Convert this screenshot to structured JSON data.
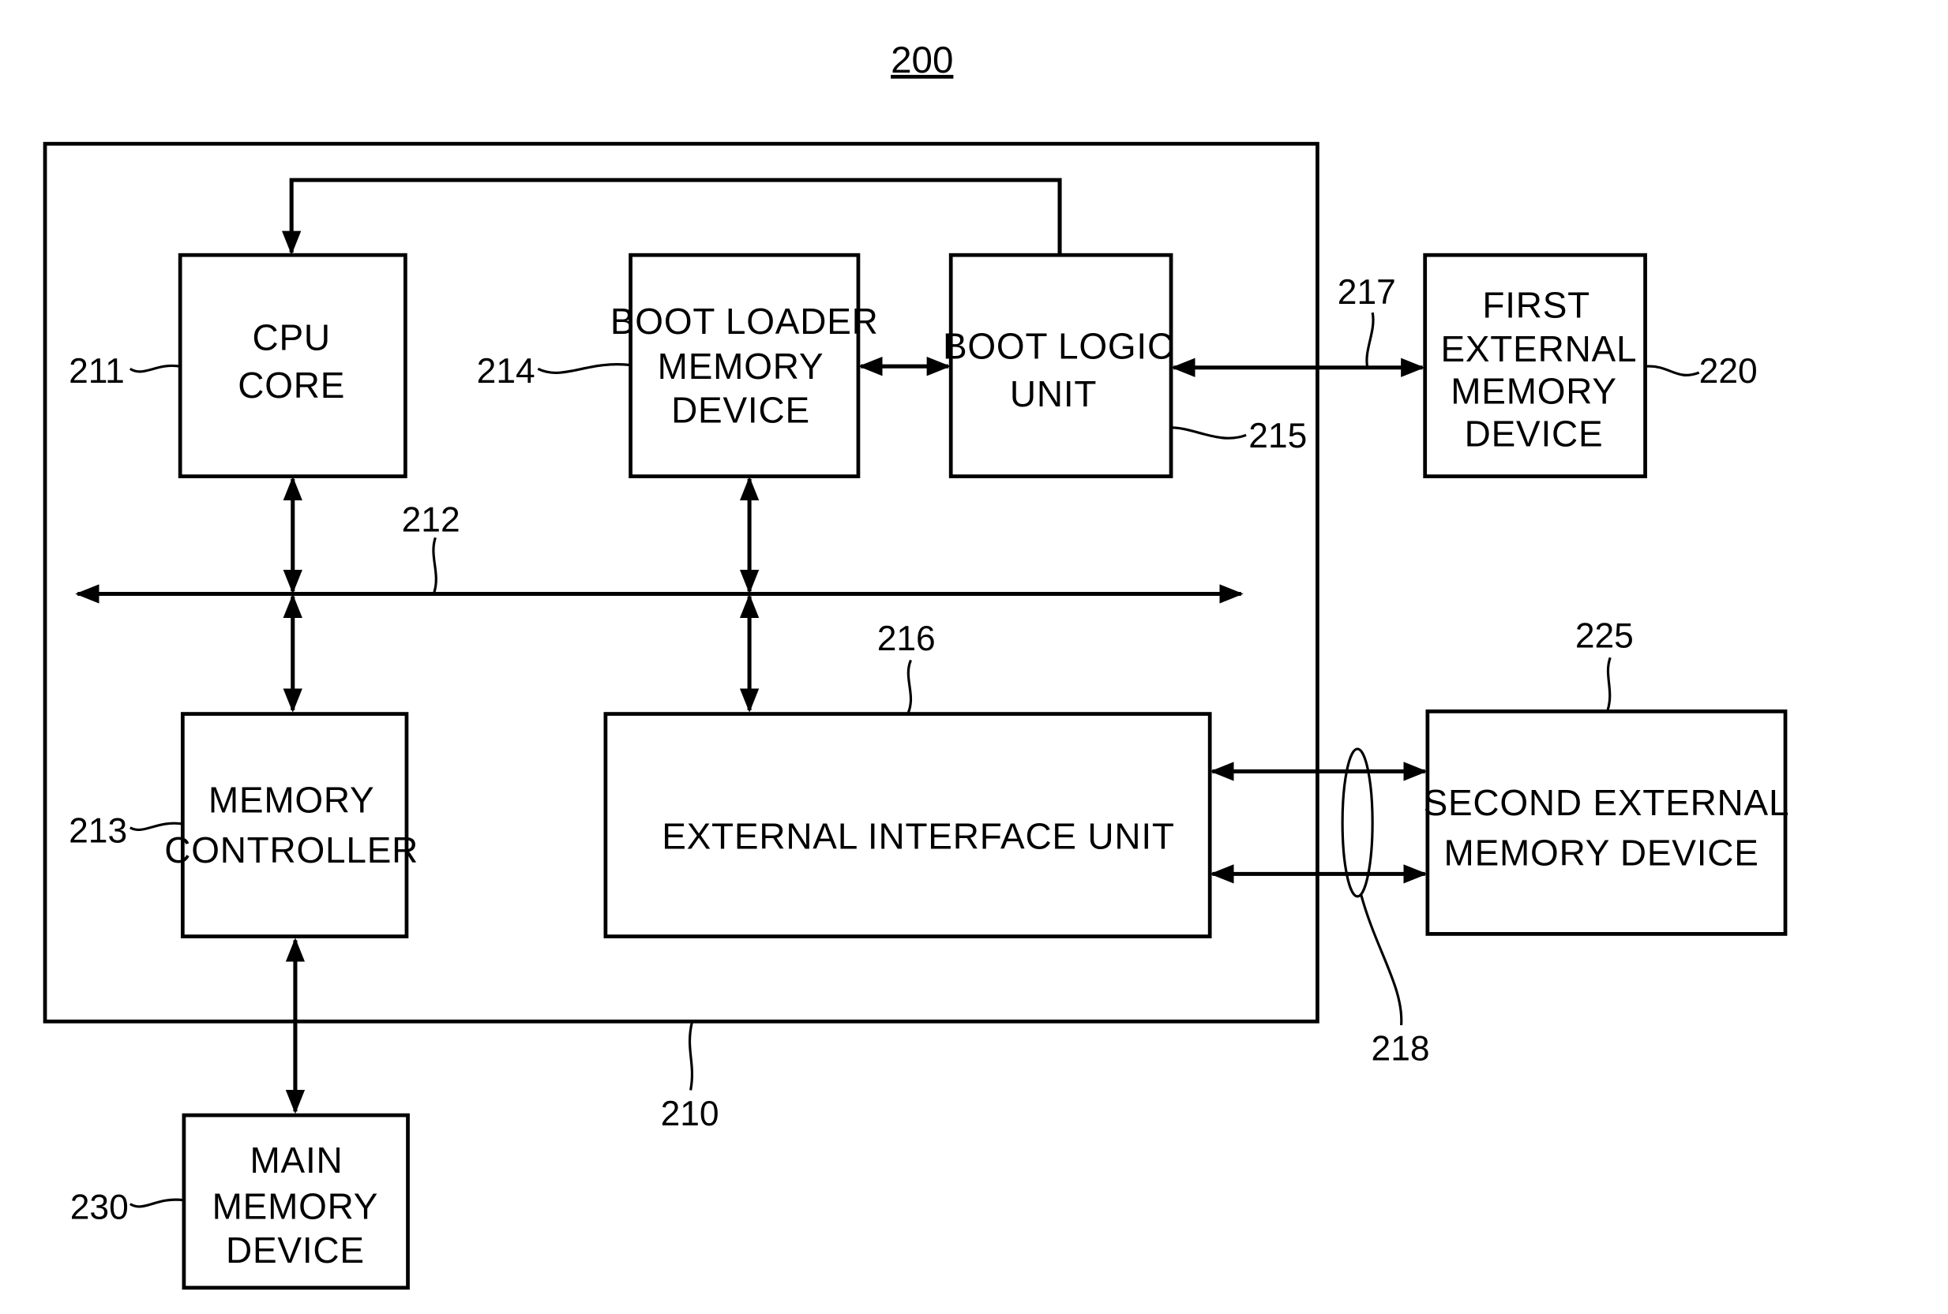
{
  "figure": {
    "reference": "200"
  },
  "blocks": {
    "system": {
      "ref": "210"
    },
    "cpu_core": {
      "ref": "211",
      "lines": [
        "CPU",
        "CORE"
      ]
    },
    "bus": {
      "ref": "212"
    },
    "memory_controller": {
      "ref": "213",
      "lines": [
        "MEMORY",
        "CONTROLLER"
      ]
    },
    "boot_loader_memory": {
      "ref": "214",
      "lines": [
        "BOOT LOADER",
        "MEMORY",
        "DEVICE"
      ]
    },
    "boot_logic_unit": {
      "ref": "215",
      "lines": [
        "BOOT LOGIC",
        "UNIT"
      ]
    },
    "external_interface_unit": {
      "ref": "216",
      "lines": [
        "EXTERNAL  INTERFACE UNIT"
      ]
    },
    "first_link": {
      "ref": "217"
    },
    "second_link": {
      "ref": "218"
    },
    "first_external_memory": {
      "ref": "220",
      "lines": [
        "FIRST",
        "EXTERNAL",
        "MEMORY",
        "DEVICE"
      ]
    },
    "second_external_memory": {
      "ref": "225",
      "lines": [
        "SECOND EXTERNAL",
        "MEMORY DEVICE"
      ]
    },
    "main_memory": {
      "ref": "230",
      "lines": [
        "MAIN",
        "MEMORY",
        "DEVICE"
      ]
    }
  },
  "colors": {
    "ink": "#000000",
    "paper": "#ffffff"
  }
}
